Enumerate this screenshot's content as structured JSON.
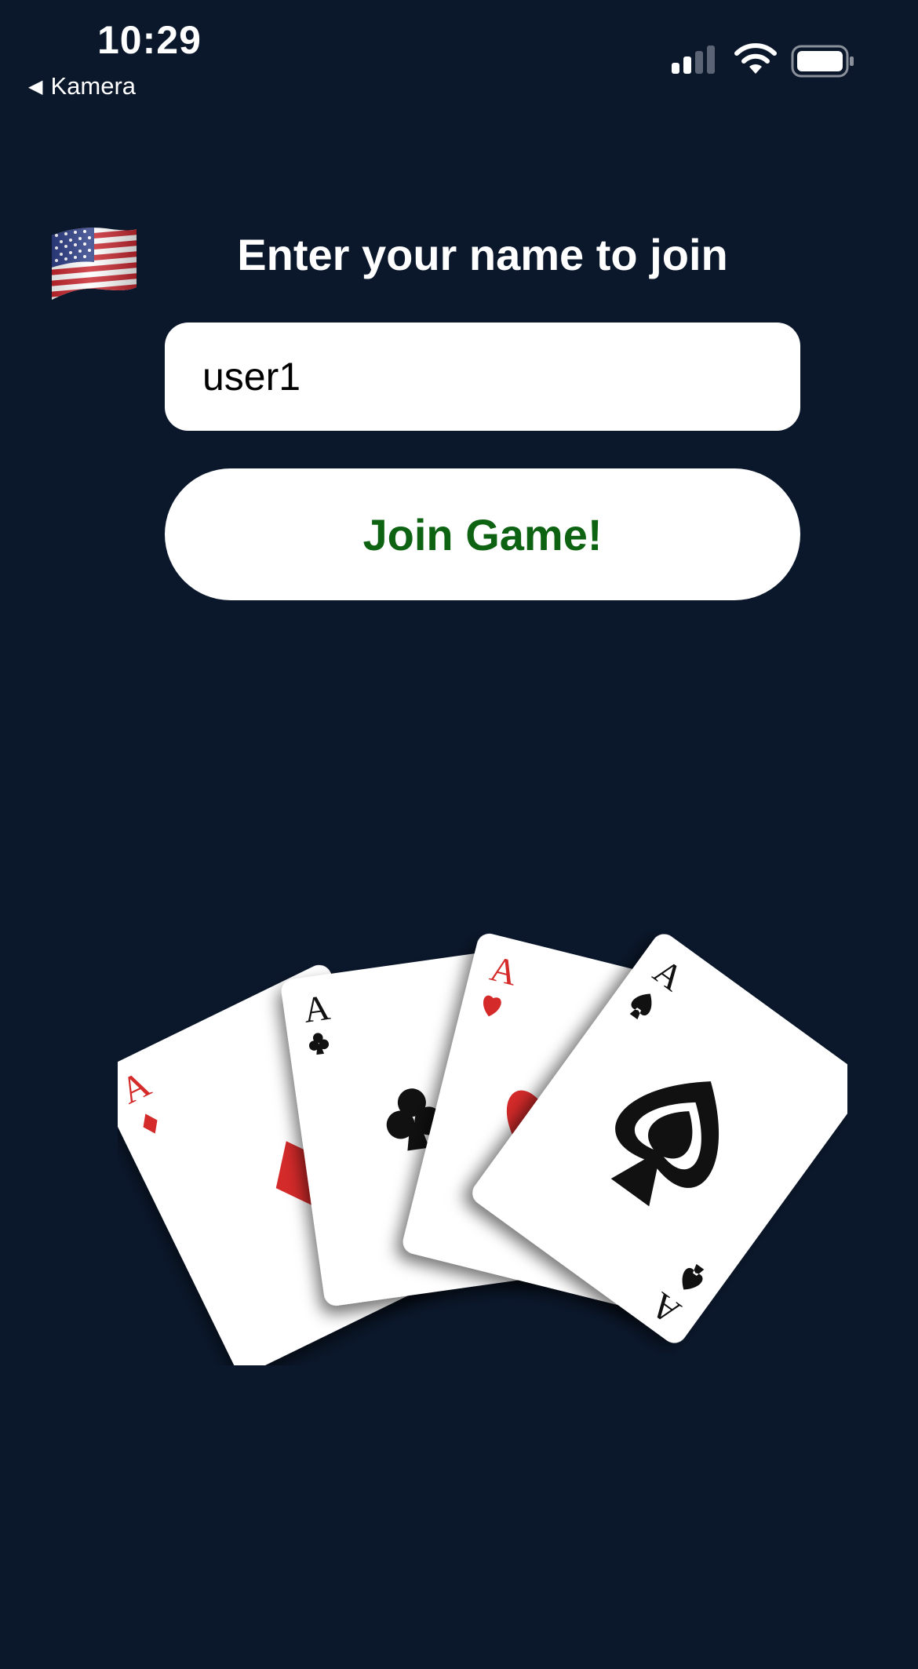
{
  "status_bar": {
    "time": "10:29",
    "back_label": "Kamera",
    "icons": [
      "signal-icon",
      "wifi-icon",
      "battery-icon"
    ]
  },
  "join": {
    "title": "Enter your name to join",
    "name_value": "user1",
    "button_label": "Join Game!"
  },
  "language_flag": "us-flag-icon",
  "cards": [
    {
      "rank": "A",
      "suit": "diamonds"
    },
    {
      "rank": "A",
      "suit": "clubs"
    },
    {
      "rank": "A",
      "suit": "hearts"
    },
    {
      "rank": "A",
      "suit": "spades"
    }
  ],
  "colors": {
    "background": "#0b182c",
    "button_text": "#0d6312",
    "red_suit": "#d42a2a"
  }
}
